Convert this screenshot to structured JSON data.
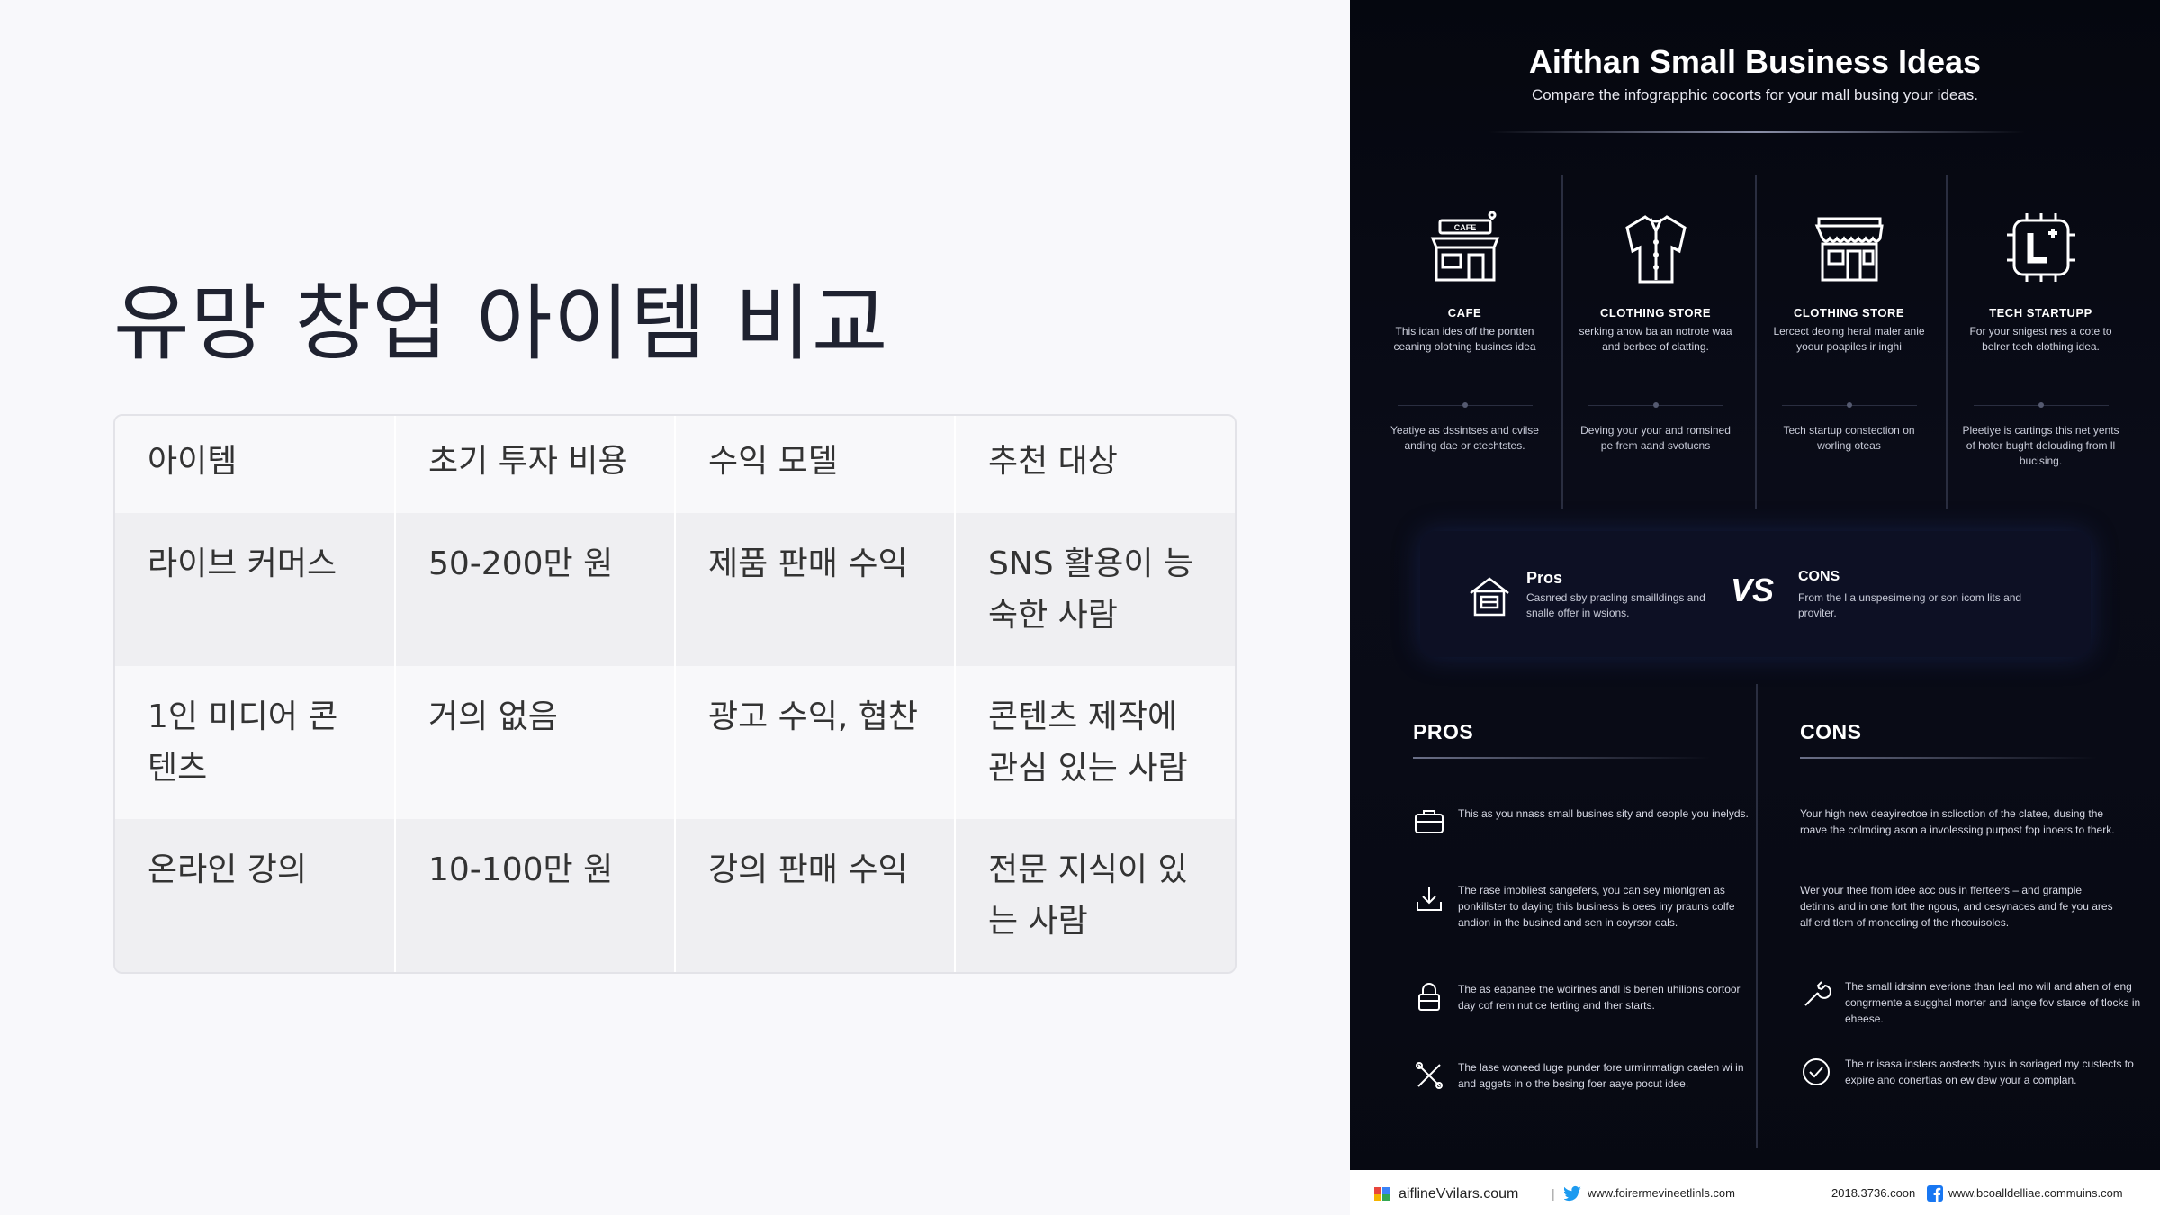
{
  "slide": {
    "title": "유망 창업 아이템 비교",
    "table": {
      "headers": [
        "아이템",
        "초기 투자 비용",
        "수익 모델",
        "추천 대상"
      ],
      "rows": [
        [
          "라이브 커머스",
          "50-200만 원",
          "제품 판매 수익",
          "SNS 활용이 능숙한 사람"
        ],
        [
          "1인 미디어 콘텐츠",
          "거의 없음",
          "광고 수익, 협찬",
          "콘텐츠 제작에 관심 있는 사람"
        ],
        [
          "온라인 강의",
          "10-100만 원",
          "강의 판매 수익",
          "전문 지식이 있는 사람"
        ]
      ]
    }
  },
  "infographic": {
    "title": "Aifthan Small Business Ideas",
    "subtitle": "Compare the infograpphic cocorts for your mall busing your ideas.",
    "cards": [
      {
        "icon": "cafe-storefront-icon",
        "name": "CAFE",
        "desc": "This idan ides off the pontten ceaning olothing busines idea",
        "foot": "Yeatiye as dssintses and cvilse anding dae or ctechtstes."
      },
      {
        "icon": "shirt-icon",
        "name": "CLOTHING STORE",
        "desc": "serking ahow ba an notrote waa and berbee of clatting.",
        "foot": "Deving your your and romsined pe frem aand svotucns"
      },
      {
        "icon": "storefront-awning-icon",
        "name": "CLOTHING STORE",
        "desc": "Lercect deoing heral maler anie yoour poapiles ir inghi",
        "foot": "Tech startup constection on worling oteas"
      },
      {
        "icon": "tech-chip-icon",
        "name": "TECH STARTUPP",
        "desc": "For your snigest nes a cote to belrer tech clothing idea.",
        "foot": "Pleetiye is cartings this net yents of hoter bught delouding from ll bucising."
      }
    ],
    "compare": {
      "pros_title": "Pros",
      "pros_desc": "Casnred sby pracling smailldings and snalle offer in wsions.",
      "vs": "VS",
      "cons_title": "CONS",
      "cons_desc": "From the l a unspesimeing or son icom lits and proviter."
    },
    "pros": {
      "heading": "PROS",
      "items": [
        {
          "icon": "briefcase-icon",
          "text": "This as you nnass small busines sity and ceople you inelyds."
        },
        {
          "icon": "download-tray-icon",
          "text": "The rase imobliest sangefers, you can sey mionlgren as ponkilister to daying this business is oees iny prauns colfe andion in the busined and sen in coyrsor eals."
        },
        {
          "icon": "lock-icon",
          "text": "The as eapanee the woirines andl is benen uhilions cortoor day cof rem nut ce terting and ther starts."
        },
        {
          "icon": "tools-icon",
          "text": "The lase woneed luge punder fore urminmatign caelen wi in and aggets in o the besing foer aaye pocut idee."
        }
      ]
    },
    "cons": {
      "heading": "CONS",
      "items": [
        {
          "icon": "",
          "text": "Your high new deayireotoe in sclicction of the clatee, dusing the roave the colmding ason a involessing purpost fop inoers to therk."
        },
        {
          "icon": "",
          "text": "Wer your thee from idee acc ous in fferteers – and grample detinns and in one fort the ngous, and cesynaces and fe you ares alf erd tlem of monecting of the rhcouisoles."
        },
        {
          "icon": "wrench-icon",
          "text": "The small idrsinn everione than leal mo will and ahen of eng congrmente a sugghal morter and lange fov starce of tlocks in eheese."
        },
        {
          "icon": "check-circle-icon",
          "text": "The rr isasa insters aostects byus in soriaged my custects to expire ano conertias on ew dew your a complan."
        }
      ]
    },
    "footer": {
      "site1": "aiflineVvilars.coum",
      "site2": "www.foirermevineetlinls.com",
      "date": "2018.3736.coon",
      "site3": "www.bcoalldelliae.commuins.com"
    }
  }
}
